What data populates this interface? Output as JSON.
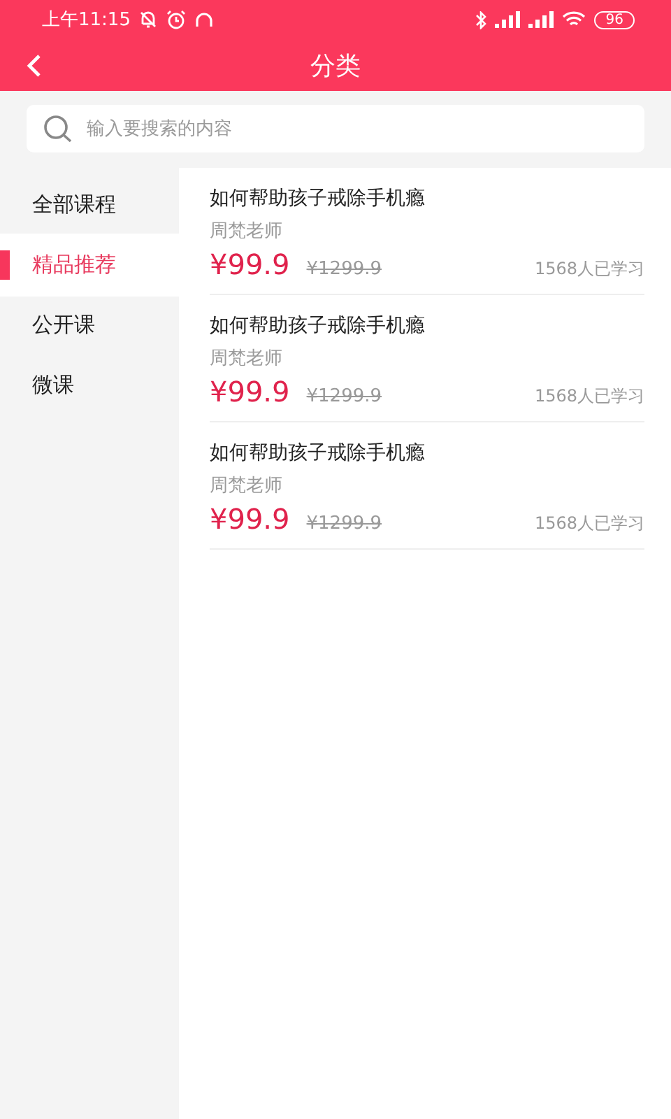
{
  "status_bar": {
    "time": "上午11:15",
    "battery": "96"
  },
  "header": {
    "title": "分类"
  },
  "search": {
    "placeholder": "输入要搜索的内容"
  },
  "sidebar": {
    "items": [
      {
        "label": "全部课程",
        "selected": false
      },
      {
        "label": "精品推荐",
        "selected": true
      },
      {
        "label": "公开课",
        "selected": false
      },
      {
        "label": "微课",
        "selected": false
      }
    ]
  },
  "courses": [
    {
      "title": "如何帮助孩子戒除手机瘾",
      "teacher": "周梵老师",
      "price": "¥99.9",
      "original_price": "¥1299.9",
      "learners": "1568人已学习"
    },
    {
      "title": "如何帮助孩子戒除手机瘾",
      "teacher": "周梵老师",
      "price": "¥99.9",
      "original_price": "¥1299.9",
      "learners": "1568人已学习"
    },
    {
      "title": "如何帮助孩子戒除手机瘾",
      "teacher": "周梵老师",
      "price": "¥99.9",
      "original_price": "¥1299.9",
      "learners": "1568人已学习"
    }
  ]
}
